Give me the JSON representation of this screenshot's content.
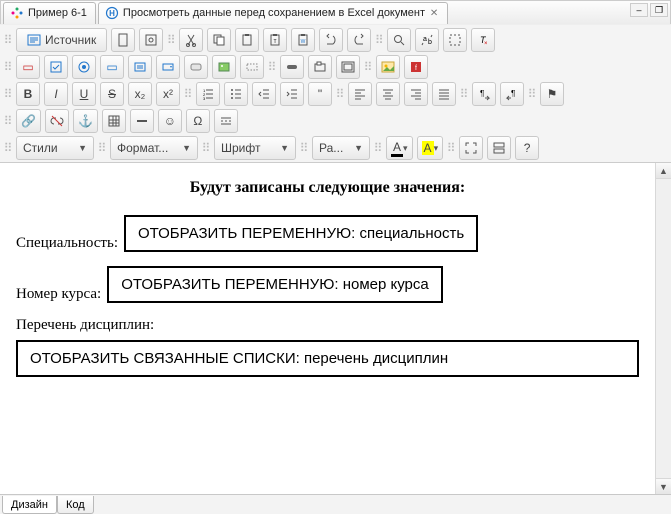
{
  "tabs": {
    "t1": "Пример 6-1",
    "t2": "Просмотреть данные перед сохранением в Excel документ"
  },
  "toolbar": {
    "source": "Источник",
    "styles": "Стили",
    "format": "Формат...",
    "font": "Шрифт",
    "size": "Ра..."
  },
  "row1": {
    "b": "B",
    "i": "I",
    "u": "U",
    "s": "S"
  },
  "doc": {
    "title": "Будут записаны следующие значения:",
    "label_spec": "Специальность:",
    "box_spec": "ОТОБРАЗИТЬ ПЕРЕМЕННУЮ: специальность",
    "label_course": "Номер курса:",
    "box_course": "ОТОБРАЗИТЬ ПЕРЕМЕННУЮ: номер курса",
    "label_disc": "Перечень дисциплин:",
    "box_disc": "ОТОБРАЗИТЬ СВЯЗАННЫЕ СПИСКИ: перечень дисциплин"
  },
  "bottom": {
    "design": "Дизайн",
    "code": "Код"
  },
  "glyph": {
    "x2u": "x²",
    "x2d": "x₂",
    "tx": "T",
    "abc": "ABC",
    "q": "\"",
    "flag": "⚑",
    "link": "🔗",
    "anchor": "⚓",
    "smile": "☺",
    "omega": "Ω"
  }
}
